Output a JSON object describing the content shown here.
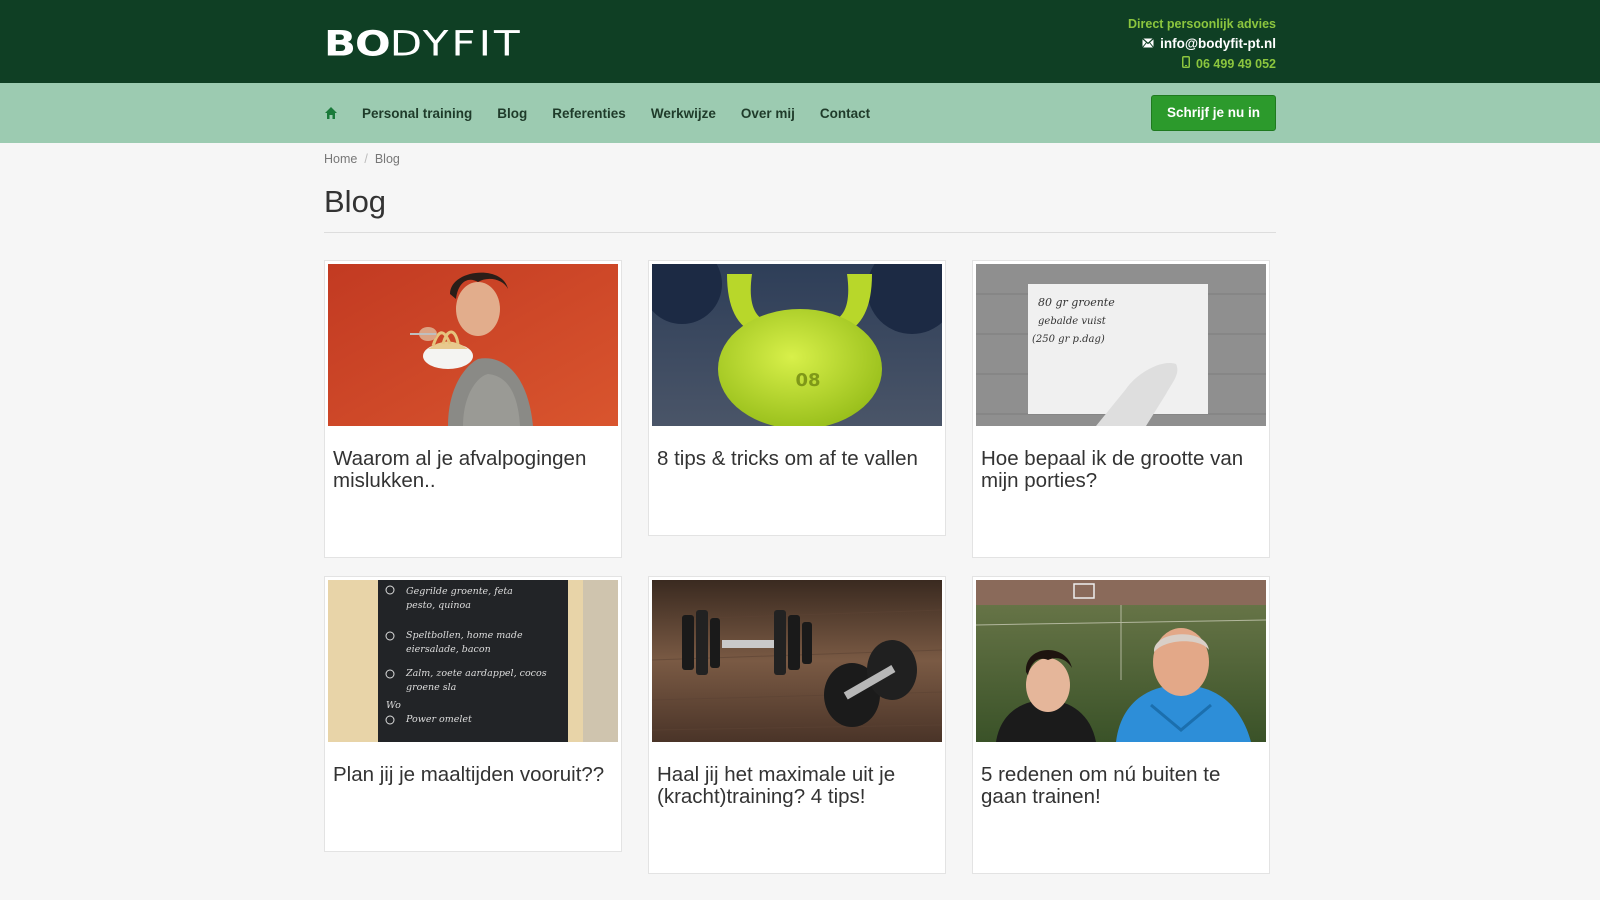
{
  "header": {
    "logo_bold": "BO",
    "logo_light": "DYFIT",
    "tagline": "Direct persoonlijk advies",
    "email": "info@bodyfit-pt.nl",
    "phone": "06 499 49 052",
    "email_icon": "envelope-icon",
    "phone_icon": "phone-icon"
  },
  "nav": {
    "home_icon": "home-icon",
    "items": [
      {
        "label": "Personal training"
      },
      {
        "label": "Blog"
      },
      {
        "label": "Referenties"
      },
      {
        "label": "Werkwijze"
      },
      {
        "label": "Over mij"
      },
      {
        "label": "Contact"
      }
    ],
    "cta_label": "Schrijf je nu in"
  },
  "breadcrumb": {
    "home": "Home",
    "separator": "/",
    "current": "Blog"
  },
  "page": {
    "title": "Blog"
  },
  "posts": [
    {
      "title": "Waarom al je afvalpogingen mislukken..",
      "image": "man eating spaghetti"
    },
    {
      "title": "8 tips & tricks om af te vallen",
      "image": "green kettlebell"
    },
    {
      "title": "Hoe bepaal ik de grootte van mijn porties?",
      "image": "handwritten note"
    },
    {
      "title": "Plan jij je maaltijden vooruit??",
      "image": "chalkboard meal plan"
    },
    {
      "title": "Haal jij het maximale uit je (kracht)training? 4 tips!",
      "image": "dumbbells"
    },
    {
      "title": "5 redenen om nú buiten te gaan trainen!",
      "image": "selfie outdoor field"
    }
  ],
  "images_text": {
    "kettlebell_number": "08",
    "note_line1": "80 gr groente",
    "note_line2": "gebalde vuist",
    "note_line3": "(250 gr p.dag)",
    "chalk_line1": "Gegrilde groente, feta",
    "chalk_line2": "pesto, quinoa",
    "chalk_line3": "Speltbollen, home made",
    "chalk_line4": "eiersalade, bacon",
    "chalk_line5": "Zalm, zoete aardappel, cocos",
    "chalk_line6": "groene sla",
    "chalk_line7": "Wo",
    "chalk_line8": "Power omelet"
  },
  "colors": {
    "topbar": "#0f3f24",
    "navbar": "#9ccbb1",
    "accent_green": "#8cc63e",
    "cta": "#2c9a2c"
  }
}
